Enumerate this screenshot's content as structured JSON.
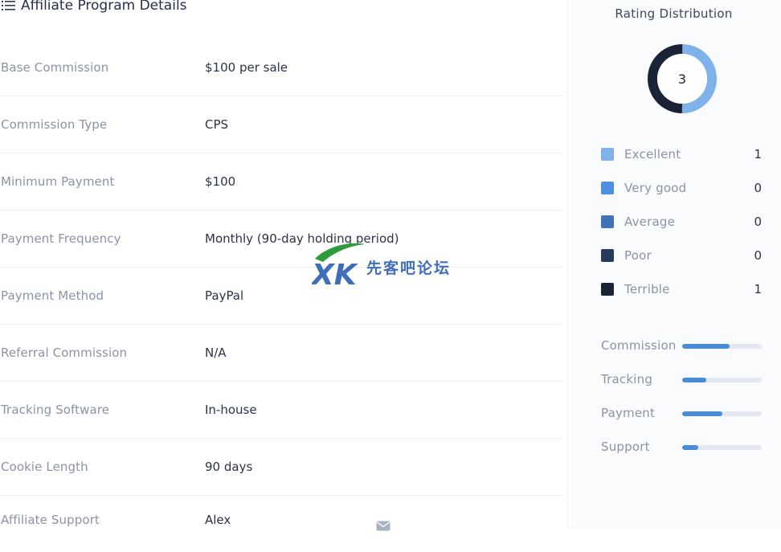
{
  "header": {
    "title": "Affiliate Program Details",
    "icon": "list-icon"
  },
  "details": [
    {
      "label": "Base Commission",
      "value": "$100 per sale"
    },
    {
      "label": "Commission Type",
      "value": "CPS"
    },
    {
      "label": "Minimum Payment",
      "value": "$100"
    },
    {
      "label": "Payment Frequency",
      "value": "Monthly (90-day holding period)"
    },
    {
      "label": "Payment Method",
      "value": "PayPal"
    },
    {
      "label": "Referral Commission",
      "value": "N/A"
    },
    {
      "label": "Tracking Software",
      "value": "In-house"
    },
    {
      "label": "Cookie Length",
      "value": "90 days"
    },
    {
      "label": "Affiliate Support",
      "value": "Alex",
      "icon": "mail-icon"
    }
  ],
  "rating": {
    "title": "Rating Distribution",
    "total": "3",
    "levels": [
      {
        "label": "Excellent",
        "count": "1",
        "color": "#7fb2ea"
      },
      {
        "label": "Very good",
        "count": "0",
        "color": "#4f8fdb"
      },
      {
        "label": "Average",
        "count": "0",
        "color": "#3f72b8"
      },
      {
        "label": "Poor",
        "count": "0",
        "color": "#263a5c"
      },
      {
        "label": "Terrible",
        "count": "1",
        "color": "#1b2437"
      }
    ],
    "donut_fractions": [
      0.5,
      0.5
    ]
  },
  "metrics": [
    {
      "label": "Commission",
      "level": 0.6
    },
    {
      "label": "Tracking",
      "level": 0.3
    },
    {
      "label": "Payment",
      "level": 0.5
    },
    {
      "label": "Support",
      "level": 0.2
    }
  ],
  "watermark": {
    "logo": "XK",
    "text": "先客吧论坛"
  }
}
